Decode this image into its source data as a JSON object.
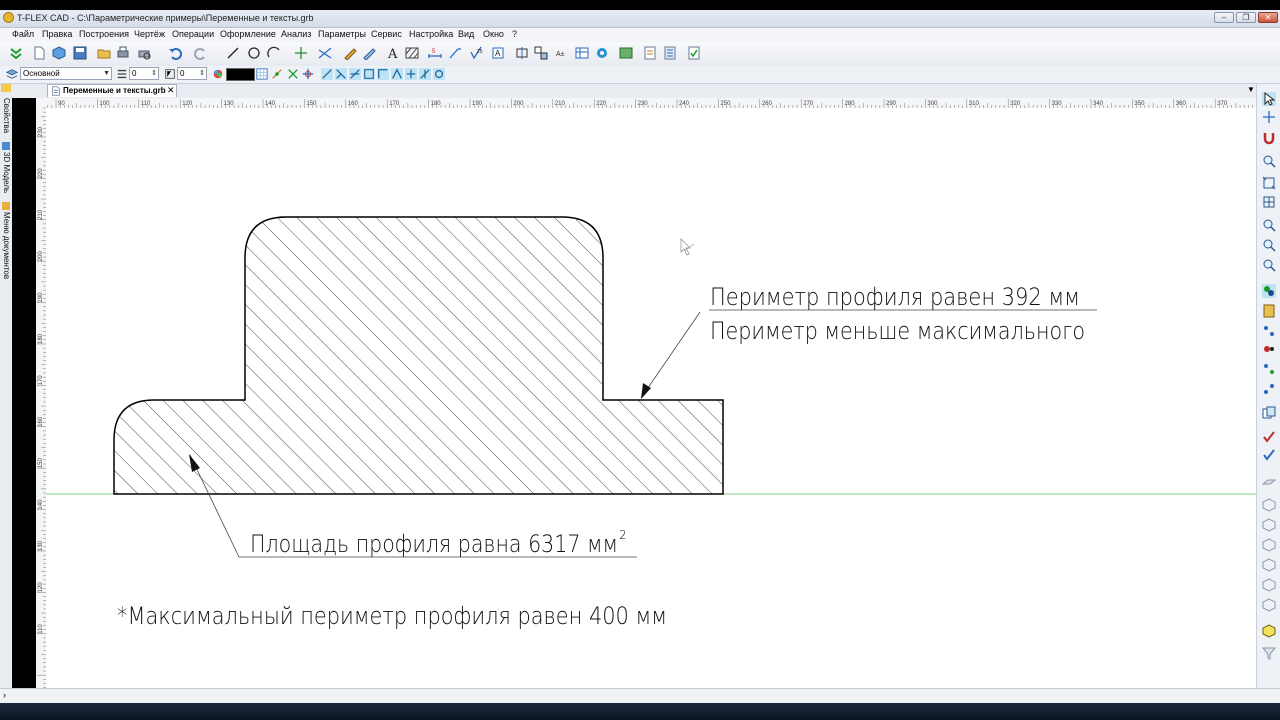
{
  "window": {
    "title": "T-FLEX CAD - C:\\Параметрические примеры\\Переменные и тексты.grb",
    "min_glyph": "–",
    "max_glyph": "❐",
    "close_glyph": "✕"
  },
  "menu": {
    "items": [
      "Файл",
      "Правка",
      "Построения",
      "Чертёж",
      "Операции",
      "Оформление",
      "Анализ",
      "Параметры",
      "Сервис",
      "Настройка",
      "Вид",
      "Окно",
      "?"
    ]
  },
  "toolbar2": {
    "layer": "Основной",
    "level_value": "0",
    "priority_value": "0"
  },
  "document_tab": {
    "label": "Переменные и тексты.grb",
    "close": "✕"
  },
  "side_tabs": [
    "Свойства",
    "3D Модель",
    "Меню документов"
  ],
  "ruler": {
    "top_labels": [
      "90",
      "100",
      "110",
      "120",
      "130",
      "140",
      "150",
      "160",
      "170",
      "180",
      "190",
      "200",
      "210",
      "220",
      "230",
      "240",
      "250",
      "260",
      "270",
      "280",
      "290",
      "300",
      "310",
      "320",
      "330",
      "340",
      "350",
      "360",
      "370"
    ],
    "left_labels": [
      "230",
      "220",
      "210",
      "200",
      "190",
      "180",
      "170",
      "160",
      "150",
      "140",
      "130",
      "120",
      "110"
    ]
  },
  "drawing": {
    "perimeter_line1": "Периметр профиля равен 392 мм",
    "perimeter_line2": "Периметр меньше максимального",
    "area_label": "Площадь профиля равна 6317 мм",
    "area_superscript": "2",
    "max_note": "*Максимальный периметр профиля равен 400 мм"
  },
  "colors": {
    "outline": "#000000",
    "hatch": "#222222",
    "baseline": "#7fd07f",
    "canvas": "#ffffff",
    "ruler": "#f4f5f7",
    "toolbar_accent": "#2a8fd6"
  },
  "icons": {
    "toolbar1": [
      "checkmark-green-icon",
      "new-file-icon",
      "3d-cube-icon",
      "save-icon",
      "open-icon",
      "print-icon",
      "print-preview-icon",
      "undo-icon",
      "redo-icon",
      "line-icon",
      "circle-icon",
      "arc-icon",
      "node-icon",
      "construction-line-icon",
      "sketch-icon",
      "hatch-edit-icon",
      "text-icon",
      "hatch-icon",
      "dimension-icon",
      "leader-icon",
      "roughness-icon",
      "tolerance-icon",
      "view-icon",
      "fragment-icon",
      "table-icon",
      "bom-icon",
      "3d-view-icon",
      "library-icon",
      "parameters-icon",
      "variables-icon",
      "check-icon"
    ],
    "toolbar2": [
      "layer-icon",
      "level-icon",
      "priority-icon",
      "color-icon",
      "snap-grid-icon",
      "snap-node-icon",
      "snap-icon-1",
      "snap-icon-2",
      "snap-icon-3",
      "snap-icon-4",
      "snap-icon-5",
      "snap-icon-6",
      "snap-icon-7",
      "snap-icon-8"
    ],
    "right": [
      "select-icon",
      "pan-icon",
      "magnet-icon",
      "zoom-icon",
      "zoom-window-icon",
      "zoom-fit-icon",
      "zoom-in-icon",
      "zoom-out-icon",
      "zoom-prev-icon",
      "layers-icon",
      "calculator-icon",
      "snap-toggle-icon",
      "filter-icon",
      "points-icon",
      "nodes-icon",
      "copy-icon",
      "check-red-icon",
      "check-multi-icon",
      "plane-icon",
      "view-front-icon",
      "view-top-icon",
      "view-left-icon",
      "view-iso-icon",
      "view-back-icon",
      "view-3d-icon",
      "box-yellow-icon",
      "funnel-icon"
    ]
  }
}
